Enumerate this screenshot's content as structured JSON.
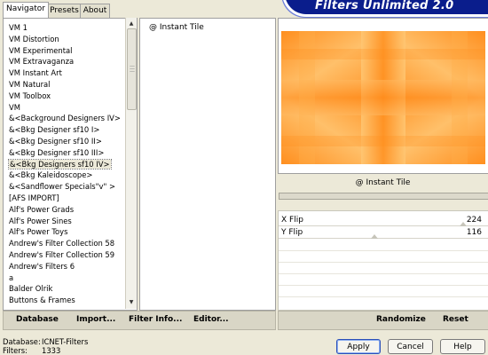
{
  "tabs": [
    {
      "label": "Navigator",
      "active": true
    },
    {
      "label": "Presets",
      "active": false
    },
    {
      "label": "About",
      "active": false
    }
  ],
  "banner": {
    "title": "Filters Unlimited 2.0",
    "color": "#0a1d8c"
  },
  "filter_list": {
    "items": [
      "VM 1",
      "VM Distortion",
      "VM Experimental",
      "VM Extravaganza",
      "VM Instant Art",
      "VM Natural",
      "VM Toolbox",
      "VM",
      "&<Background Designers IV>",
      "&<Bkg Designer sf10 I>",
      "&<Bkg Designer sf10 II>",
      "&<Bkg Designer sf10 III>",
      "&<Bkg Designers sf10 IV>",
      "&<Bkg Kaleidoscope>",
      "&<Sandflower Specials\"v\" >",
      "[AFS IMPORT]",
      "Alf's Power Grads",
      "Alf's Power Sines",
      "Alf's Power Toys",
      "Andrew's Filter Collection 58",
      "Andrew's Filter Collection 59",
      "Andrew's Filters 6",
      "a",
      "Balder Olrik",
      "Buttons & Frames"
    ],
    "selected_index": 12
  },
  "subfilter": {
    "selected": "@ Instant Tile"
  },
  "preview": {
    "accent_color": "#ff9a2e"
  },
  "filter_title": "@ Instant Tile",
  "controls": [
    {
      "label": "X Flip",
      "value": "224",
      "fraction": 0.878
    },
    {
      "label": "Y Flip",
      "value": "116",
      "fraction": 0.455
    }
  ],
  "left_buttons": [
    {
      "label": "Database"
    },
    {
      "label": "Import..."
    },
    {
      "label": "Filter Info..."
    },
    {
      "label": "Editor..."
    }
  ],
  "right_buttons": [
    {
      "label": "Randomize"
    },
    {
      "label": "Reset"
    }
  ],
  "status": {
    "database_label": "Database:",
    "database_value": "ICNET-Filters",
    "filters_label": "Filters:",
    "filters_value": "1333"
  },
  "dialog_buttons": {
    "apply": "Apply",
    "cancel": "Cancel",
    "help": "Help"
  }
}
